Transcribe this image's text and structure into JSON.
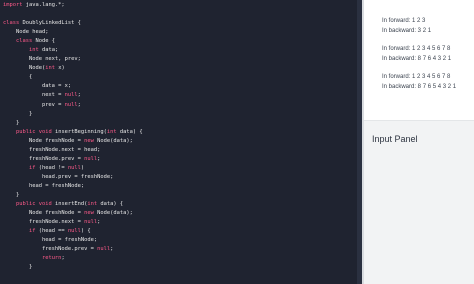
{
  "editor": {
    "lines": [
      [
        {
          "t": "import",
          "c": "kw"
        },
        {
          "t": " java.lang.*;"
        }
      ],
      [
        {
          "t": ""
        }
      ],
      [
        {
          "t": "class",
          "c": "kw"
        },
        {
          "t": " DoublyLinkedList {"
        }
      ],
      [
        {
          "t": "    Node head;"
        }
      ],
      [
        {
          "t": "    "
        },
        {
          "t": "class",
          "c": "kw"
        },
        {
          "t": " Node {"
        }
      ],
      [
        {
          "t": "        "
        },
        {
          "t": "int",
          "c": "ty"
        },
        {
          "t": " data;"
        }
      ],
      [
        {
          "t": "        Node next, prev;"
        }
      ],
      [
        {
          "t": "        Node("
        },
        {
          "t": "int",
          "c": "ty"
        },
        {
          "t": " x)"
        }
      ],
      [
        {
          "t": "        {"
        }
      ],
      [
        {
          "t": "            data = x;"
        }
      ],
      [
        {
          "t": "            next = "
        },
        {
          "t": "null",
          "c": "kw"
        },
        {
          "t": ";"
        }
      ],
      [
        {
          "t": "            prev = "
        },
        {
          "t": "null",
          "c": "kw"
        },
        {
          "t": ";"
        }
      ],
      [
        {
          "t": "        }"
        }
      ],
      [
        {
          "t": "    }"
        }
      ],
      [
        {
          "t": "    "
        },
        {
          "t": "public",
          "c": "kw"
        },
        {
          "t": " "
        },
        {
          "t": "void",
          "c": "kw"
        },
        {
          "t": " insertBeginning("
        },
        {
          "t": "int",
          "c": "ty"
        },
        {
          "t": " data) {"
        }
      ],
      [
        {
          "t": "        Node freshNode = "
        },
        {
          "t": "new",
          "c": "kw"
        },
        {
          "t": " Node(data);"
        }
      ],
      [
        {
          "t": "        freshNode.next = head;"
        }
      ],
      [
        {
          "t": "        freshNode.prev = "
        },
        {
          "t": "null",
          "c": "kw"
        },
        {
          "t": ";"
        }
      ],
      [
        {
          "t": "        "
        },
        {
          "t": "if",
          "c": "kw"
        },
        {
          "t": " (head != "
        },
        {
          "t": "null",
          "c": "kw"
        },
        {
          "t": ")"
        }
      ],
      [
        {
          "t": "            head.prev = freshNode;"
        }
      ],
      [
        {
          "t": "        head = freshNode;"
        }
      ],
      [
        {
          "t": "    }"
        }
      ],
      [
        {
          "t": "    "
        },
        {
          "t": "public",
          "c": "kw"
        },
        {
          "t": " "
        },
        {
          "t": "void",
          "c": "kw"
        },
        {
          "t": " insertEnd("
        },
        {
          "t": "int",
          "c": "ty"
        },
        {
          "t": " data) {"
        }
      ],
      [
        {
          "t": "        Node freshNode = "
        },
        {
          "t": "new",
          "c": "kw"
        },
        {
          "t": " Node(data);"
        }
      ],
      [
        {
          "t": "        freshNode.next = "
        },
        {
          "t": "null",
          "c": "kw"
        },
        {
          "t": ";"
        }
      ],
      [
        {
          "t": "        "
        },
        {
          "t": "if",
          "c": "kw"
        },
        {
          "t": " (head == "
        },
        {
          "t": "null",
          "c": "kw"
        },
        {
          "t": ") {"
        }
      ],
      [
        {
          "t": "            head = freshNode;"
        }
      ],
      [
        {
          "t": "            freshNode.prev = "
        },
        {
          "t": "null",
          "c": "kw"
        },
        {
          "t": ";"
        }
      ],
      [
        {
          "t": "            "
        },
        {
          "t": "return",
          "c": "kw"
        },
        {
          "t": ";"
        }
      ],
      [
        {
          "t": "        }"
        }
      ]
    ]
  },
  "output": {
    "lines": [
      "In forward: 1 2 3",
      "In backward: 3 2 1",
      "In forward: 1 2 3 4 5 6 7 8",
      "In backward: 8 7 6 4 3 2 1",
      "In forward: 1 2 3 4 5 6 7 8",
      "In backward: 8 7 6 5 4 3 2 1"
    ]
  },
  "input_panel": {
    "title": "Input Panel"
  },
  "colors": {
    "editor_bg": "#1f2330",
    "keyword": "#ff5a8a",
    "code_text": "#e8e8e8",
    "panel_bg": "#f2f3f4"
  }
}
